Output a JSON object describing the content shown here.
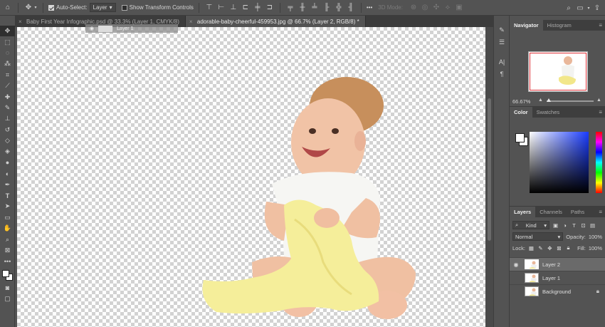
{
  "options_bar": {
    "auto_select_label": "Auto-Select:",
    "auto_select_value": "Layer",
    "transform_controls_label": "Show Transform Controls",
    "three_d_mode_label": "3D Mode:",
    "more_label": "•••"
  },
  "tabs": [
    {
      "label": "Baby First Year Infographic.psd @ 33.3% (Layer 1, CMYK/8)"
    },
    {
      "label": "adorable-baby-cheerful-459953.jpg @ 66.7% (Layer 2, RGB/8) *"
    }
  ],
  "drag_ghost": {
    "label": "Layer 1"
  },
  "navigator": {
    "tabs": [
      "Navigator",
      "Histogram"
    ],
    "zoom": "66.67%"
  },
  "color": {
    "tabs": [
      "Color",
      "Swatches"
    ]
  },
  "layers": {
    "tabs": [
      "Layers",
      "Channels",
      "Paths"
    ],
    "kind_label": "Kind",
    "blend_mode": "Normal",
    "opacity_label": "Opacity:",
    "opacity_value": "100%",
    "lock_label": "Lock:",
    "fill_label": "Fill:",
    "fill_value": "100%",
    "items": [
      {
        "name": "Layer 2"
      },
      {
        "name": "Layer 1"
      },
      {
        "name": "Background"
      }
    ]
  },
  "colors": {
    "ui_bg": "#535353",
    "panel_tab_bg": "#3e3e3e",
    "selected_layer": "#6a6a6a",
    "navigator_frame": "#e0333a",
    "cloth": "#f5ee9a",
    "onesie": "#f7f7f5",
    "skin": "#f2c2a5",
    "hair": "#c88f5a"
  }
}
